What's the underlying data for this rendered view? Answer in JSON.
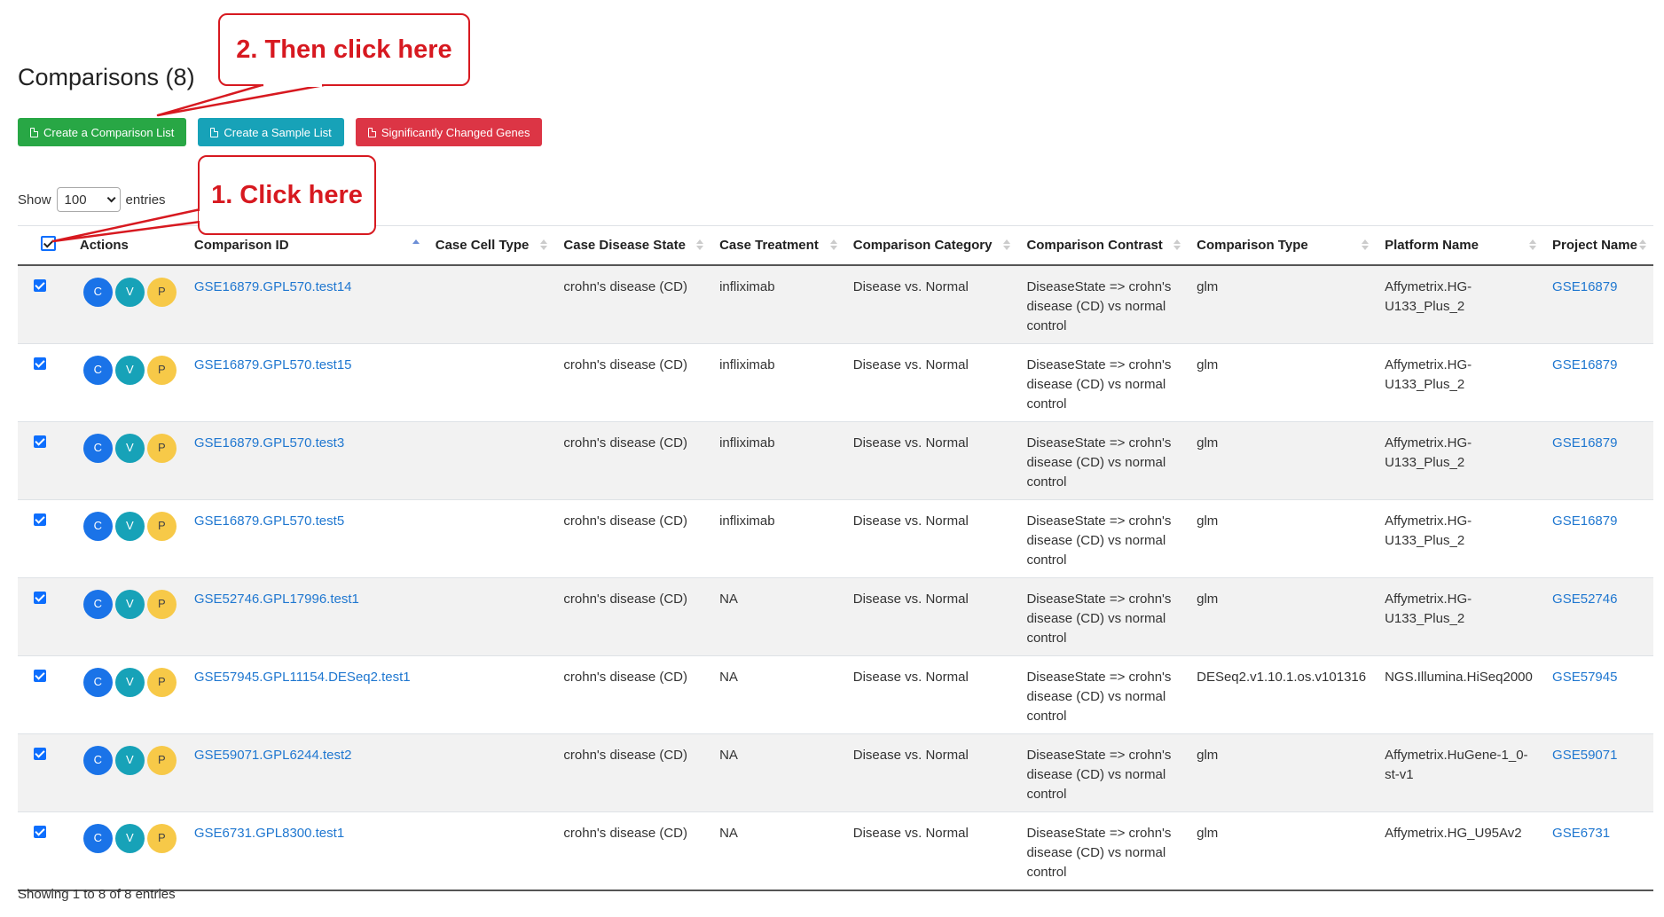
{
  "page": {
    "title": "Comparisons (8)"
  },
  "buttons": {
    "create_comparison_list": "Create a Comparison List",
    "create_sample_list": "Create a Sample List",
    "significantly_changed_genes": "Significantly Changed Genes"
  },
  "length": {
    "show": "Show",
    "value": "100",
    "entries": "entries"
  },
  "table": {
    "headers": [
      "Actions",
      "Comparison ID",
      "Case Cell Type",
      "Case Disease State",
      "Case Treatment",
      "Comparison Category",
      "Comparison Contrast",
      "Comparison Type",
      "Platform Name",
      "Project Name"
    ],
    "action_labels": {
      "c": "C",
      "v": "V",
      "p": "P"
    },
    "rows": [
      {
        "comparison_id": "GSE16879.GPL570.test14",
        "case_cell_type": "",
        "case_disease_state": "crohn's disease (CD)",
        "case_treatment": "infliximab",
        "comparison_category": "Disease vs. Normal",
        "comparison_contrast": "DiseaseState => crohn's disease (CD) vs normal control",
        "comparison_type": "glm",
        "platform_name": "Affymetrix.HG-U133_Plus_2",
        "project_name": "GSE16879"
      },
      {
        "comparison_id": "GSE16879.GPL570.test15",
        "case_cell_type": "",
        "case_disease_state": "crohn's disease (CD)",
        "case_treatment": "infliximab",
        "comparison_category": "Disease vs. Normal",
        "comparison_contrast": "DiseaseState => crohn's disease (CD) vs normal control",
        "comparison_type": "glm",
        "platform_name": "Affymetrix.HG-U133_Plus_2",
        "project_name": "GSE16879"
      },
      {
        "comparison_id": "GSE16879.GPL570.test3",
        "case_cell_type": "",
        "case_disease_state": "crohn's disease (CD)",
        "case_treatment": "infliximab",
        "comparison_category": "Disease vs. Normal",
        "comparison_contrast": "DiseaseState => crohn's disease (CD) vs normal control",
        "comparison_type": "glm",
        "platform_name": "Affymetrix.HG-U133_Plus_2",
        "project_name": "GSE16879"
      },
      {
        "comparison_id": "GSE16879.GPL570.test5",
        "case_cell_type": "",
        "case_disease_state": "crohn's disease (CD)",
        "case_treatment": "infliximab",
        "comparison_category": "Disease vs. Normal",
        "comparison_contrast": "DiseaseState => crohn's disease (CD) vs normal control",
        "comparison_type": "glm",
        "platform_name": "Affymetrix.HG-U133_Plus_2",
        "project_name": "GSE16879"
      },
      {
        "comparison_id": "GSE52746.GPL17996.test1",
        "case_cell_type": "",
        "case_disease_state": "crohn's disease (CD)",
        "case_treatment": "NA",
        "comparison_category": "Disease vs. Normal",
        "comparison_contrast": "DiseaseState => crohn's disease (CD) vs normal control",
        "comparison_type": "glm",
        "platform_name": "Affymetrix.HG-U133_Plus_2",
        "project_name": "GSE52746"
      },
      {
        "comparison_id": "GSE57945.GPL11154.DESeq2.test1",
        "case_cell_type": "",
        "case_disease_state": "crohn's disease (CD)",
        "case_treatment": "NA",
        "comparison_category": "Disease vs. Normal",
        "comparison_contrast": "DiseaseState => crohn's disease (CD) vs normal control",
        "comparison_type": "DESeq2.v1.10.1.os.v101316",
        "platform_name": "NGS.Illumina.HiSeq2000",
        "project_name": "GSE57945"
      },
      {
        "comparison_id": "GSE59071.GPL6244.test2",
        "case_cell_type": "",
        "case_disease_state": "crohn's disease (CD)",
        "case_treatment": "NA",
        "comparison_category": "Disease vs. Normal",
        "comparison_contrast": "DiseaseState => crohn's disease (CD) vs normal control",
        "comparison_type": "glm",
        "platform_name": "Affymetrix.HuGene-1_0-st-v1",
        "project_name": "GSE59071"
      },
      {
        "comparison_id": "GSE6731.GPL8300.test1",
        "case_cell_type": "",
        "case_disease_state": "crohn's disease (CD)",
        "case_treatment": "NA",
        "comparison_category": "Disease vs. Normal",
        "comparison_contrast": "DiseaseState => crohn's disease (CD) vs normal control",
        "comparison_type": "glm",
        "platform_name": "Affymetrix.HG_U95Av2",
        "project_name": "GSE6731"
      }
    ]
  },
  "footer": {
    "info": "Showing 1 to 8 of 8 entries"
  },
  "annotations": {
    "step1": "1. Click here",
    "step2": "2. Then click here"
  },
  "colors": {
    "green": "#28a745",
    "teal": "#17a2b8",
    "red": "#dc3545",
    "link": "#1f77d0",
    "callout": "#d71920",
    "circle_c": "#1a73e8",
    "circle_p": "#f7c948"
  },
  "icons": [
    "document-icon",
    "sort-icon",
    "checkbox-icon",
    "chevron-down-icon"
  ]
}
